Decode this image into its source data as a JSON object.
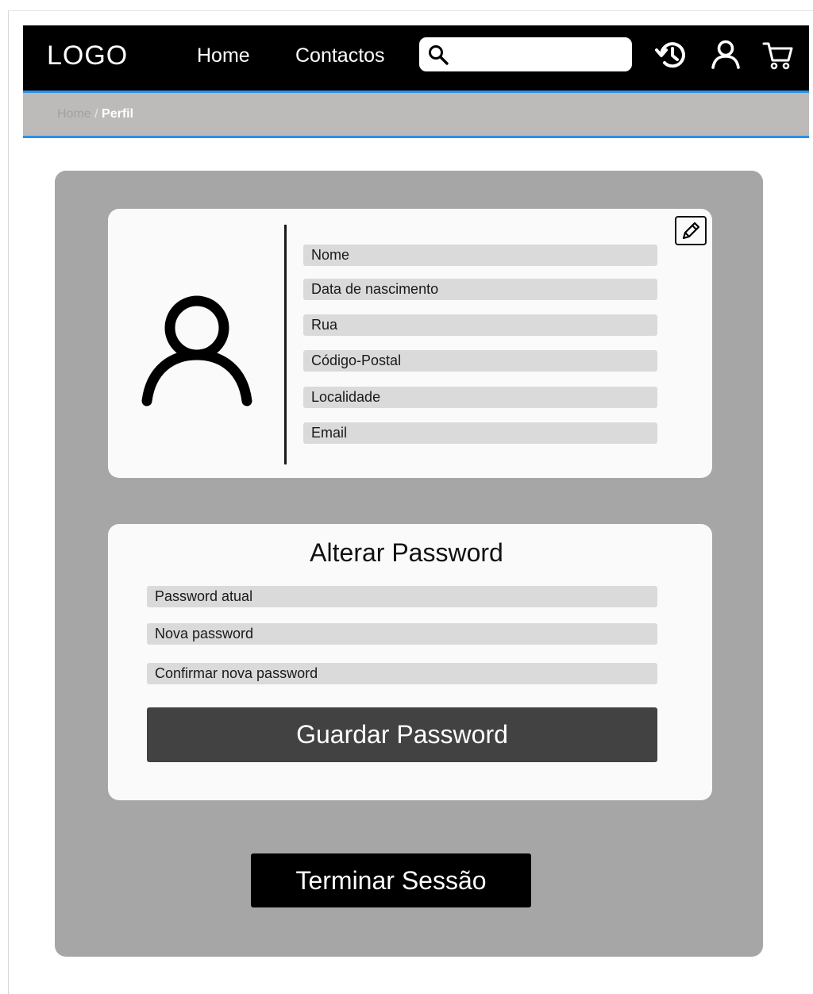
{
  "header": {
    "logo": "LOGO",
    "nav": [
      {
        "label": "Home"
      },
      {
        "label": "Contactos"
      }
    ],
    "search": {
      "value": "",
      "placeholder": ""
    },
    "icons": [
      "history-icon",
      "user-icon",
      "cart-icon"
    ]
  },
  "breadcrumb": {
    "home": "Home",
    "separator": "/",
    "current": "Perfil"
  },
  "profile": {
    "avatar_icon": "user-icon",
    "edit_icon": "pencil-icon",
    "fields": [
      {
        "label": "Nome"
      },
      {
        "label": "Data de nascimento"
      },
      {
        "label": "Rua"
      },
      {
        "label": "Código-Postal"
      },
      {
        "label": "Localidade"
      },
      {
        "label": "Email"
      }
    ]
  },
  "password": {
    "title": "Alterar Password",
    "fields": [
      {
        "label": "Password atual"
      },
      {
        "label": "Nova password"
      },
      {
        "label": "Confirmar nova password"
      }
    ],
    "save_label": "Guardar Password"
  },
  "logout_label": "Terminar Sessão",
  "colors": {
    "navbar": "#000000",
    "accent_line": "#2f8fe6",
    "breadcrumb_bg": "#bdbbb9",
    "panel": "#a6a6a6",
    "card": "#fafafa",
    "field": "#dadada",
    "save_button": "#424242",
    "logout_button": "#000000"
  }
}
